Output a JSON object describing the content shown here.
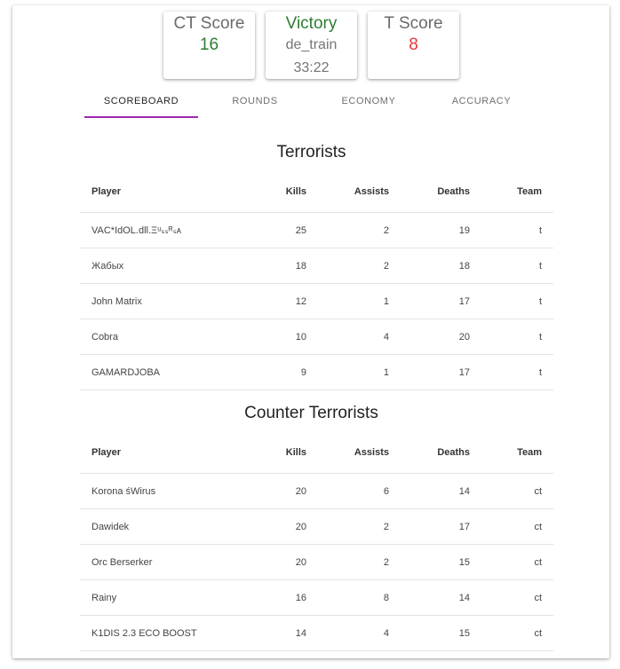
{
  "scores": {
    "ct_label": "CT Score",
    "ct_value": "16",
    "result": "Victory",
    "map": "de_train",
    "time": "33:22",
    "t_label": "T Score",
    "t_value": "8"
  },
  "colors": {
    "ct": "#2e7d32",
    "t": "#e53935",
    "victory": "#2e7d32",
    "tab_indicator": "#9c27b0"
  },
  "tabs": [
    "Scoreboard",
    "Rounds",
    "Economy",
    "Accuracy"
  ],
  "columns": {
    "player": "Player",
    "kills": "Kills",
    "assists": "Assists",
    "deaths": "Deaths",
    "team": "Team"
  },
  "terrorists": {
    "title": "Terrorists",
    "rows": [
      {
        "player": "VAC*IdOL.dll.Ξᵘₛₛᴿₛᴀ",
        "kills": "25",
        "assists": "2",
        "deaths": "19",
        "team": "t"
      },
      {
        "player": "Жабых",
        "kills": "18",
        "assists": "2",
        "deaths": "18",
        "team": "t"
      },
      {
        "player": "John Matrix",
        "kills": "12",
        "assists": "1",
        "deaths": "17",
        "team": "t"
      },
      {
        "player": "Cobra",
        "kills": "10",
        "assists": "4",
        "deaths": "20",
        "team": "t"
      },
      {
        "player": "GAMARDJOBA",
        "kills": "9",
        "assists": "1",
        "deaths": "17",
        "team": "t"
      }
    ]
  },
  "counter_terrorists": {
    "title": "Counter Terrorists",
    "rows": [
      {
        "player": "Korona śWirus",
        "kills": "20",
        "assists": "6",
        "deaths": "14",
        "team": "ct"
      },
      {
        "player": "Dawidek",
        "kills": "20",
        "assists": "2",
        "deaths": "17",
        "team": "ct"
      },
      {
        "player": "Orc Berserker",
        "kills": "20",
        "assists": "2",
        "deaths": "15",
        "team": "ct"
      },
      {
        "player": "Rainy",
        "kills": "16",
        "assists": "8",
        "deaths": "14",
        "team": "ct"
      },
      {
        "player": "K1DIS 2.3 ECO BOOST",
        "kills": "14",
        "assists": "4",
        "deaths": "15",
        "team": "ct"
      }
    ]
  }
}
